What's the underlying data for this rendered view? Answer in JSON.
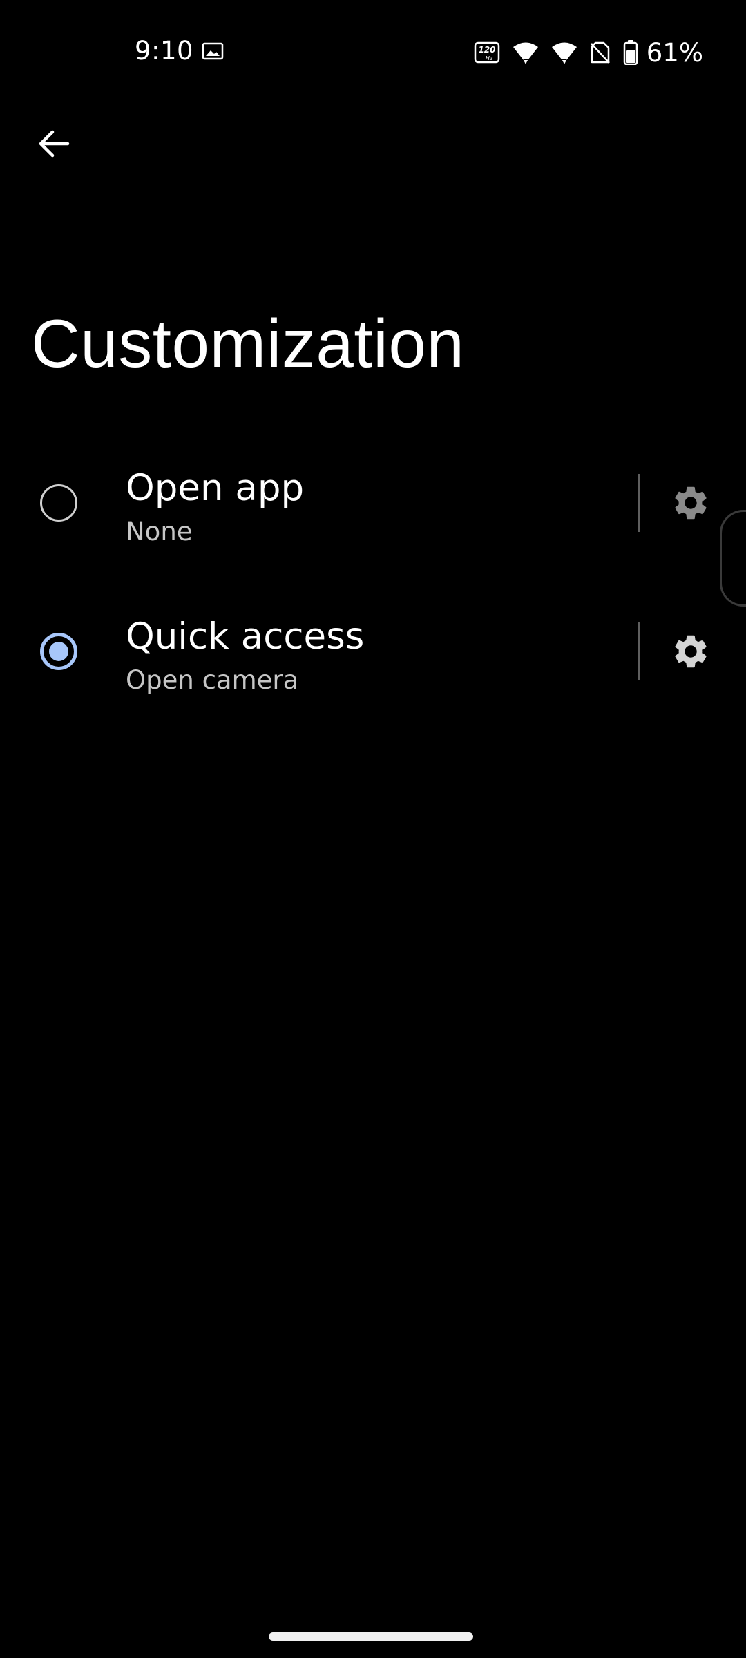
{
  "status_bar": {
    "time": "9:10",
    "battery_percent": "61%",
    "icons": [
      "image-icon",
      "refresh-rate-icon",
      "wifi-icon",
      "signal-icon",
      "no-sim-icon",
      "battery-icon"
    ],
    "refresh_rate_label": "120",
    "refresh_rate_unit": "Hz"
  },
  "toolbar": {
    "back_icon": "arrow-left-icon"
  },
  "page": {
    "title": "Customization"
  },
  "options": [
    {
      "title": "Open app",
      "subtitle": "None",
      "selected": false,
      "settings_icon": "gear-icon"
    },
    {
      "title": "Quick access",
      "subtitle": "Open camera",
      "selected": true,
      "settings_icon": "gear-icon"
    }
  ],
  "colors": {
    "background": "#000000",
    "accent": "#a8c7fa",
    "text_primary": "#ffffff",
    "text_secondary": "#c6c6c6",
    "icon_disabled": "#8a8a8a",
    "icon_enabled": "#d4d4d4"
  }
}
